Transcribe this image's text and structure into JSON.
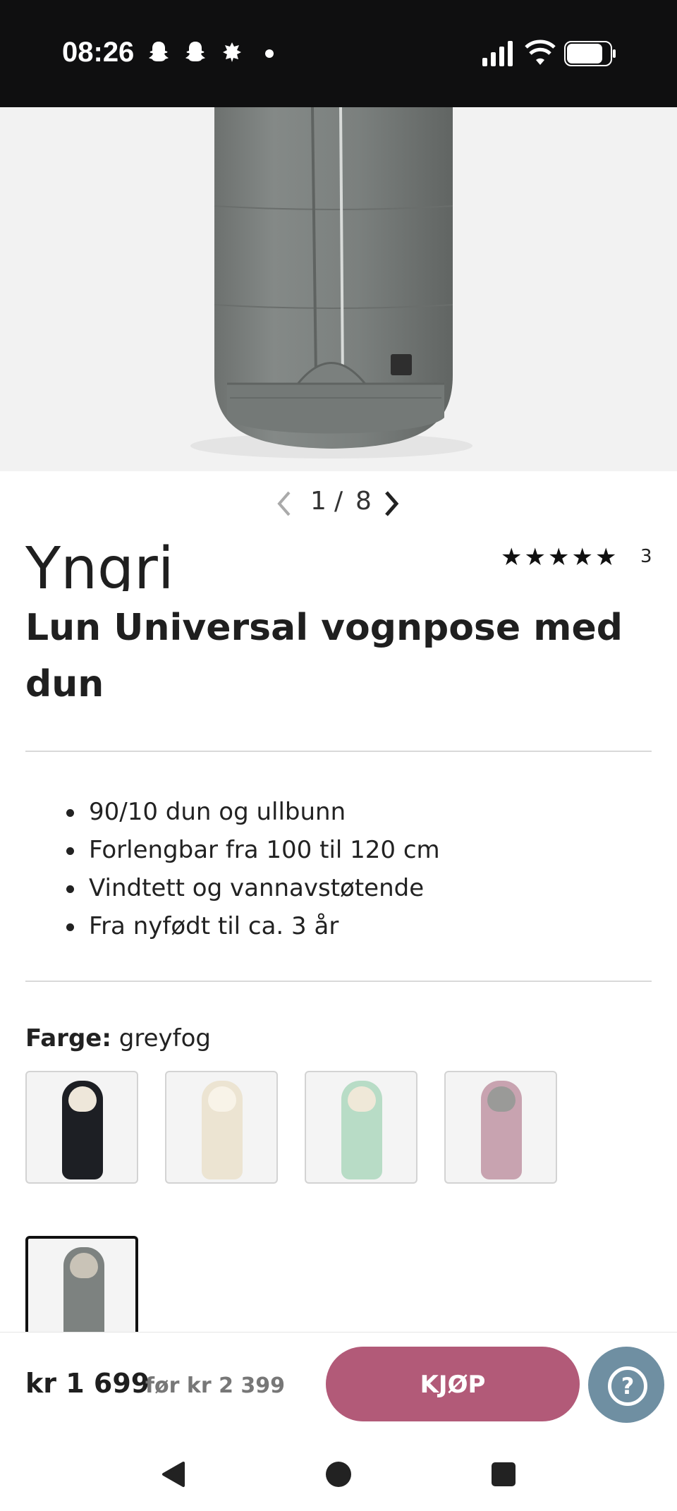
{
  "status_bar": {
    "time": "08:26",
    "notification_icons": [
      "snapchat-icon",
      "snapchat-icon",
      "notification-icon"
    ],
    "system_icons": [
      "cellular-signal-icon",
      "wifi-icon",
      "battery-icon"
    ]
  },
  "gallery": {
    "current": "1",
    "separator": "/",
    "total": "8",
    "prev_icon": "chevron-left-icon",
    "next_icon": "chevron-right-icon"
  },
  "product": {
    "brand": "Yngri",
    "rating_stars": 5,
    "review_count": "3",
    "title": "Lun Universal vognpose med dun",
    "features": [
      "90/10 dun og ullbunn",
      "Forlengbar fra 100 til 120 cm",
      "Vindtett og vannavstøtende",
      "Fra nyfødt til ca. 3 år"
    ],
    "color_label": "Farge:",
    "color_value": "greyfog",
    "swatches": [
      {
        "name": "black",
        "body": "#1d1f24",
        "hood": "#eee7da"
      },
      {
        "name": "cream",
        "body": "#ece4d2",
        "hood": "#f5efe2"
      },
      {
        "name": "mint",
        "body": "#b8dcc6",
        "hood": "#efe8d8"
      },
      {
        "name": "rose",
        "body": "#c8a3b0",
        "hood": "#9a9a98"
      },
      {
        "name": "greyfog",
        "body": "#7d8280",
        "hood": "#c9c3b7",
        "selected": true
      }
    ]
  },
  "purchase": {
    "price": "kr 1 699",
    "old_price": "før kr 2 399",
    "buy_label": "KJØP",
    "buy_color": "#b25a78",
    "help_icon": "help-question-icon",
    "help_color": "#6f8fa2"
  },
  "android_nav": [
    "back-icon",
    "home-icon",
    "recents-icon"
  ]
}
